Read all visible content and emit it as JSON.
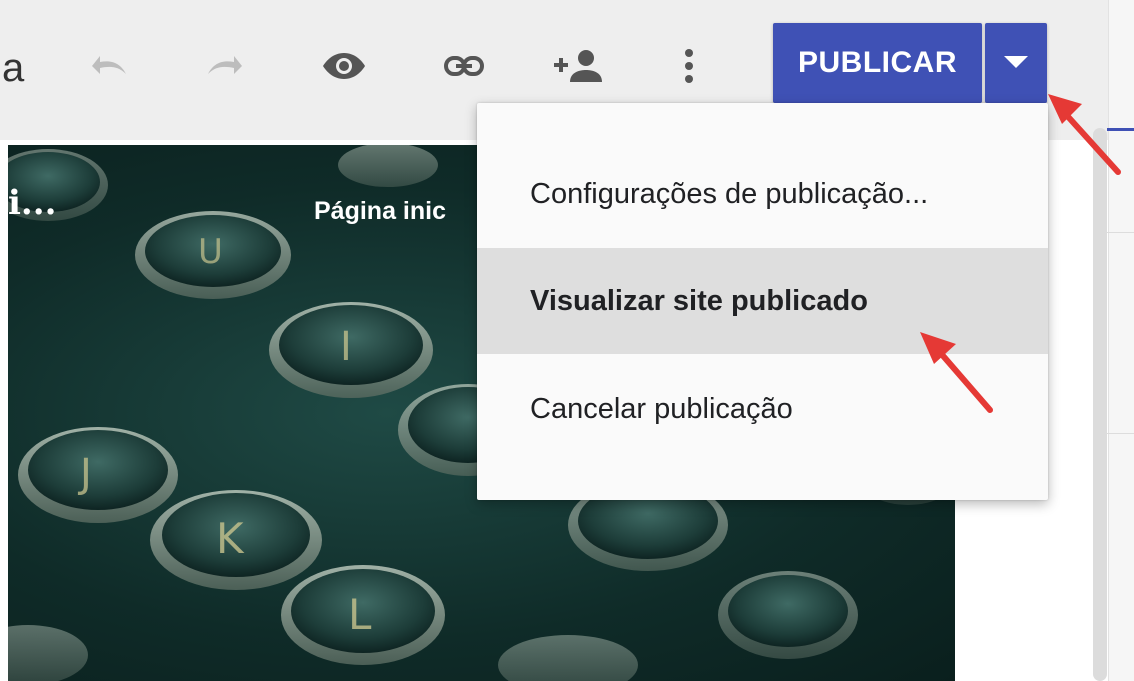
{
  "toolbar": {
    "title_fragment": "a",
    "icons": [
      "undo-icon",
      "redo-icon",
      "preview-eye-icon",
      "link-icon",
      "add-person-icon",
      "more-vert-icon"
    ],
    "publish_label": "PUBLICAR",
    "publish_dropdown_icon": "caret-down-icon"
  },
  "hero": {
    "site_title_fragment": "i...",
    "nav_fragment": "Página inic",
    "background": "typewriter-keys-photo"
  },
  "menu": {
    "items": [
      {
        "label": "Configurações de publicação..."
      },
      {
        "label": "Visualizar site publicado",
        "highlighted": true
      },
      {
        "label": "Cancelar publicação"
      }
    ]
  },
  "colors": {
    "accent": "#3f51b5",
    "toolbar_bg": "#eeeeee",
    "menu_bg": "#fafafa",
    "menu_highlight": "#dedede",
    "annotation_arrow": "#e53935"
  }
}
